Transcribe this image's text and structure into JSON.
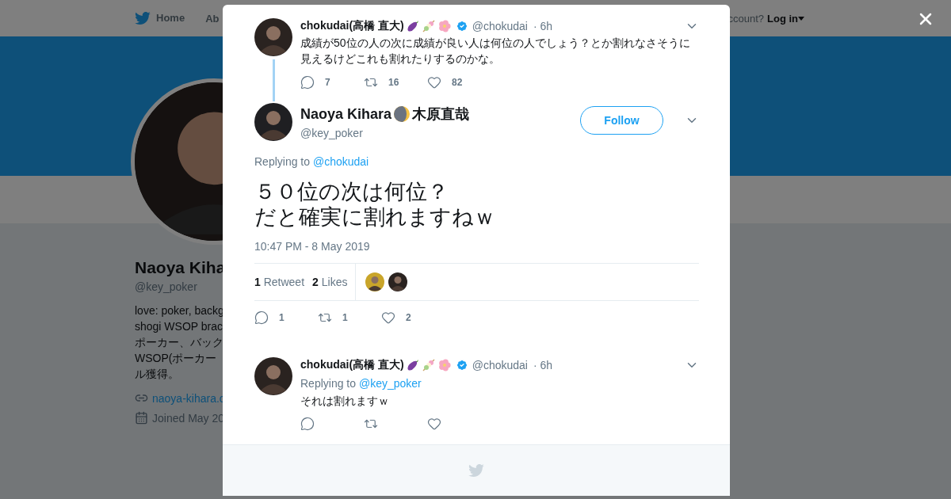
{
  "nav": {
    "items": [
      {
        "label": "Home",
        "kind": "home"
      },
      {
        "label": "Ab",
        "kind": "plain"
      }
    ],
    "account_prompt": "ccount?",
    "login": "Log in"
  },
  "profile": {
    "name": "Naoya Kiha",
    "handle": "@key_poker",
    "bio": [
      "love: poker, backg",
      "shogi WSOP brac",
      "ポーカー、バック",
      "WSOP(ポーカー",
      "ル獲得。"
    ],
    "website": "naoya-kihara.c",
    "joined": "Joined May 20"
  },
  "thread": {
    "parent": {
      "name": "chokudai(高橋 直大)",
      "verified": true,
      "handle": "@chokudai",
      "time": "· 6h",
      "text": "成績が50位の人の次に成績が良い人は何位の人でしょう？とか割れなさそうに見えるけどこれも割れたりするのかな。",
      "actions": [
        {
          "kind": "reply",
          "count": "7"
        },
        {
          "kind": "retweet",
          "count": "16"
        },
        {
          "kind": "like",
          "count": "82"
        }
      ]
    },
    "main": {
      "name": "Naoya Kihara",
      "name_suffix": "木原直哉",
      "handle": "@key_poker",
      "follow": "Follow",
      "replying_label": "Replying to",
      "replying_to": "@chokudai",
      "text": [
        "５０位の次は何位？",
        "だと確実に割れますねｗ"
      ],
      "timestamp": "10:47 PM - 8 May 2019",
      "stats": [
        "**1** Retweet",
        "**2** Likes"
      ],
      "actions": [
        {
          "kind": "reply",
          "count": "1"
        },
        {
          "kind": "retweet",
          "count": "1"
        },
        {
          "kind": "like",
          "count": "2"
        }
      ]
    },
    "replies": [
      {
        "name": "chokudai(高橋 直大)",
        "verified": true,
        "handle": "@chokudai",
        "time": "· 6h",
        "replying_label": "Replying to",
        "replying_to": "@key_poker",
        "text": "それは割れますｗ",
        "actions": [
          {
            "kind": "reply"
          },
          {
            "kind": "retweet"
          },
          {
            "kind": "like"
          }
        ]
      }
    ]
  }
}
